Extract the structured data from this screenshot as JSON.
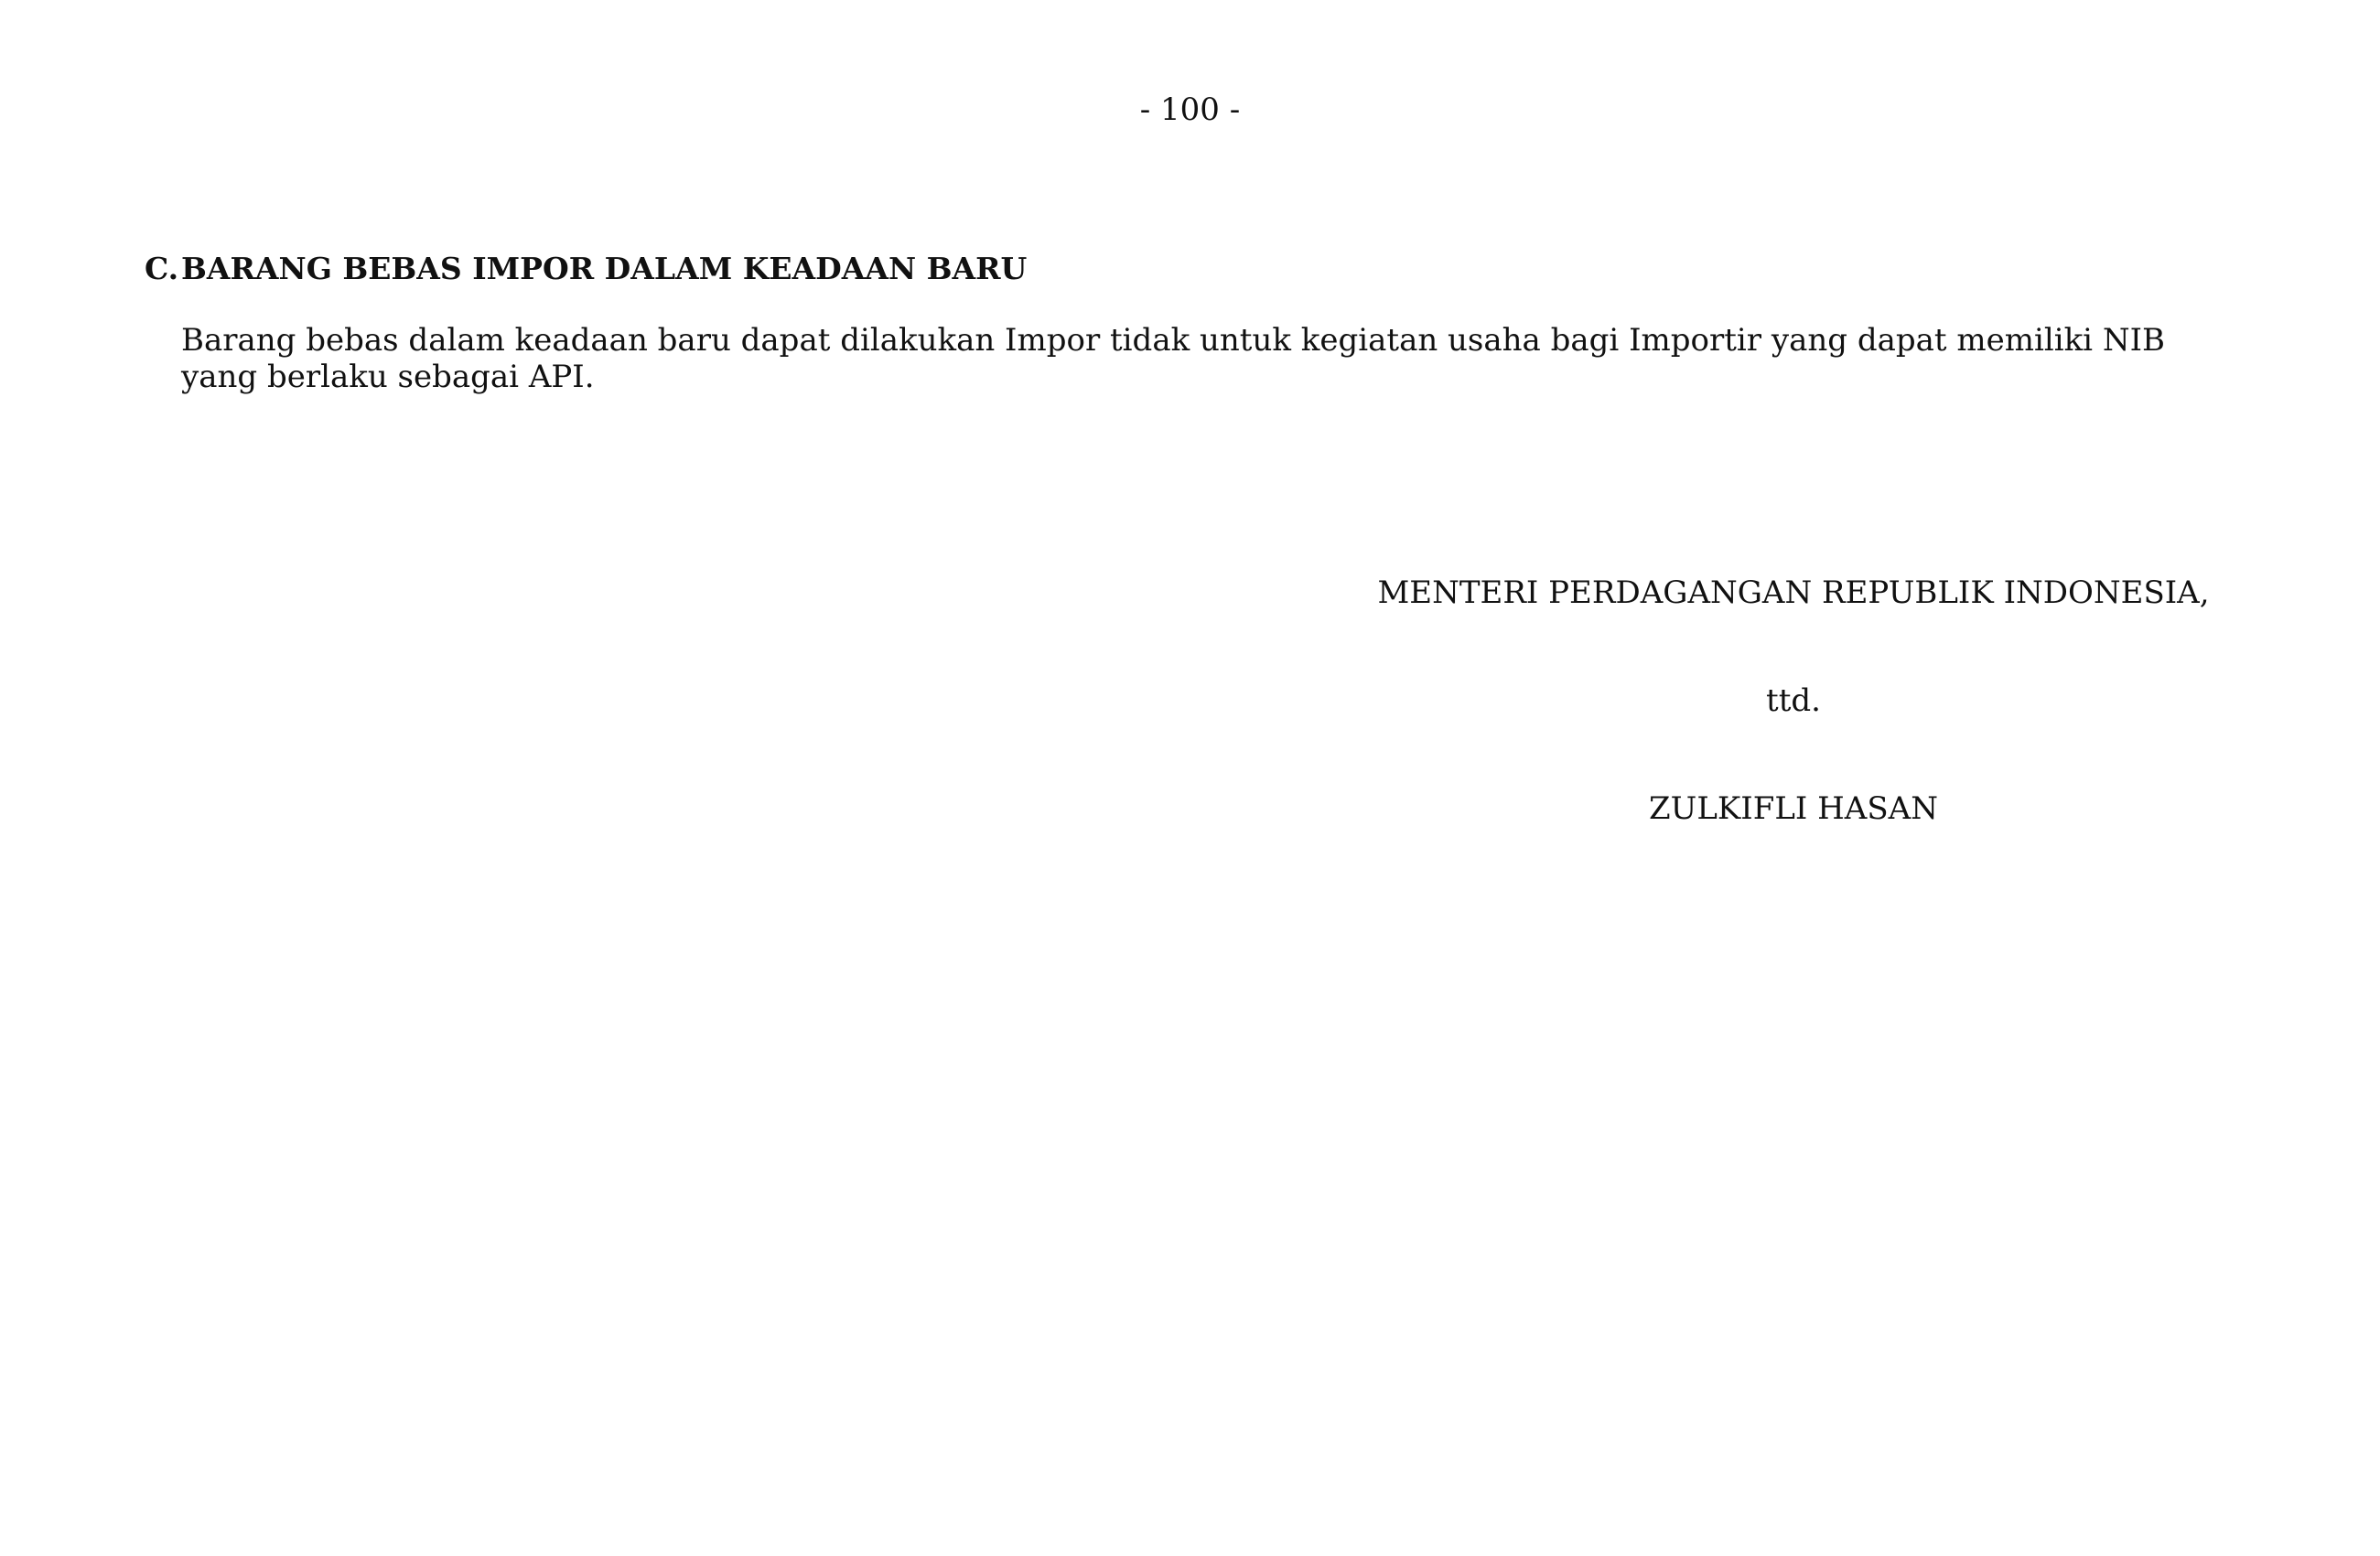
{
  "page_number": "- 100 -",
  "section": {
    "letter": "C.",
    "title": "BARANG BEBAS IMPOR DALAM KEADAAN BARU",
    "body": "Barang bebas dalam keadaan baru dapat dilakukan Impor tidak untuk kegiatan usaha bagi Importir yang dapat memiliki NIB yang berlaku sebagai API."
  },
  "signature": {
    "office": "MENTERI PERDAGANGAN REPUBLIK INDONESIA,",
    "ttd": "ttd.",
    "name": "ZULKIFLI HASAN"
  }
}
